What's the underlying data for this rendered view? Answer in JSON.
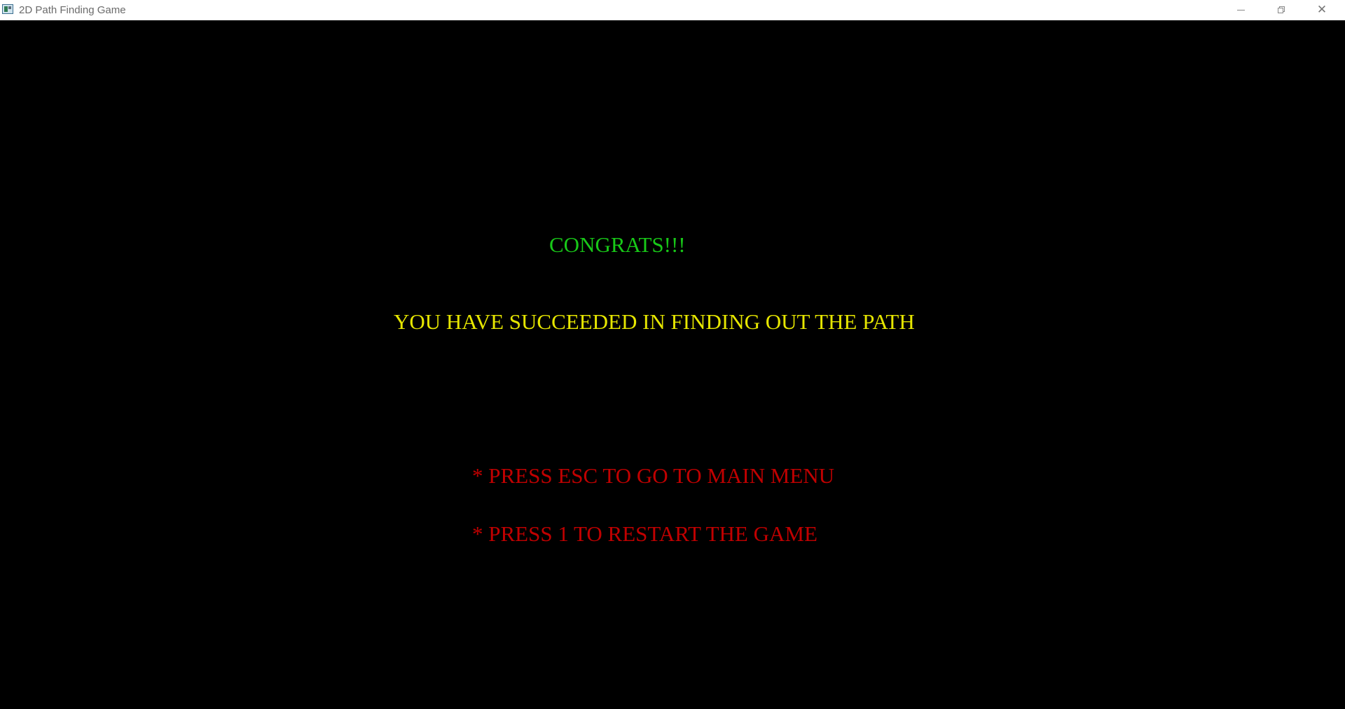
{
  "window": {
    "title": "2D Path Finding Game",
    "icon": "app-window-icon",
    "controls": {
      "minimize": "minimize-icon",
      "maximize": "restore-icon",
      "close": "close-icon"
    }
  },
  "screen": {
    "congrats": "CONGRATS!!!",
    "success_message": "YOU HAVE SUCCEEDED IN FINDING OUT THE PATH",
    "options": [
      "* PRESS ESC TO GO TO MAIN MENU",
      "* PRESS 1 TO RESTART THE GAME"
    ]
  },
  "colors": {
    "background": "#000000",
    "congrats": "#18c818",
    "success": "#e6e600",
    "options": "#c00000"
  }
}
